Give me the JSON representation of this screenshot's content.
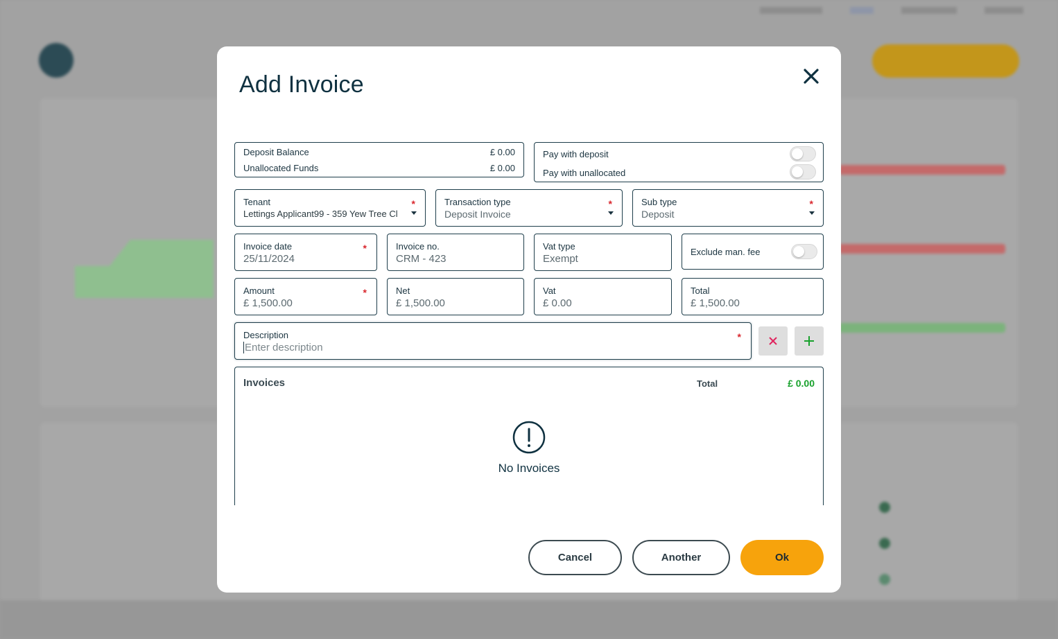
{
  "modal": {
    "title": "Add Invoice",
    "close_icon": "close-icon"
  },
  "balances": {
    "deposit_label": "Deposit Balance",
    "deposit_value": "£ 0.00",
    "unallocated_label": "Unallocated Funds",
    "unallocated_value": "£ 0.00"
  },
  "pay_toggles": {
    "pay_with_deposit": "Pay with deposit",
    "pay_with_unallocated": "Pay with unallocated"
  },
  "tenant": {
    "label": "Tenant",
    "value": "Lettings Applicant99 - 359 Yew Tree Cl"
  },
  "transaction_type": {
    "label": "Transaction type",
    "value": "Deposit Invoice"
  },
  "sub_type": {
    "label": "Sub type",
    "value": "Deposit"
  },
  "invoice_date": {
    "label": "Invoice date",
    "value": "25/11/2024"
  },
  "invoice_no": {
    "label": "Invoice no.",
    "value": "CRM - 423"
  },
  "vat_type": {
    "label": "Vat type",
    "value": "Exempt"
  },
  "exclude_fee": {
    "label": "Exclude man. fee"
  },
  "amount": {
    "label": "Amount",
    "value": "£ 1,500.00"
  },
  "net": {
    "label": "Net",
    "value": "£ 1,500.00"
  },
  "vat": {
    "label": "Vat",
    "value": "£ 0.00"
  },
  "total": {
    "label": "Total",
    "value": "£ 1,500.00"
  },
  "description": {
    "label": "Description",
    "placeholder": "Enter description"
  },
  "required_mark": "*",
  "invoices": {
    "title": "Invoices",
    "total_label": "Total",
    "total_value": "£ 0.00",
    "empty_text": "No Invoices"
  },
  "actions": {
    "cancel": "Cancel",
    "another": "Another",
    "ok": "Ok"
  },
  "colors": {
    "accent": "#f7a30c",
    "dark": "#0f3140",
    "required": "#d9272e",
    "positive": "#18a12c",
    "remove": "#e0245e",
    "add": "#18a12c"
  }
}
